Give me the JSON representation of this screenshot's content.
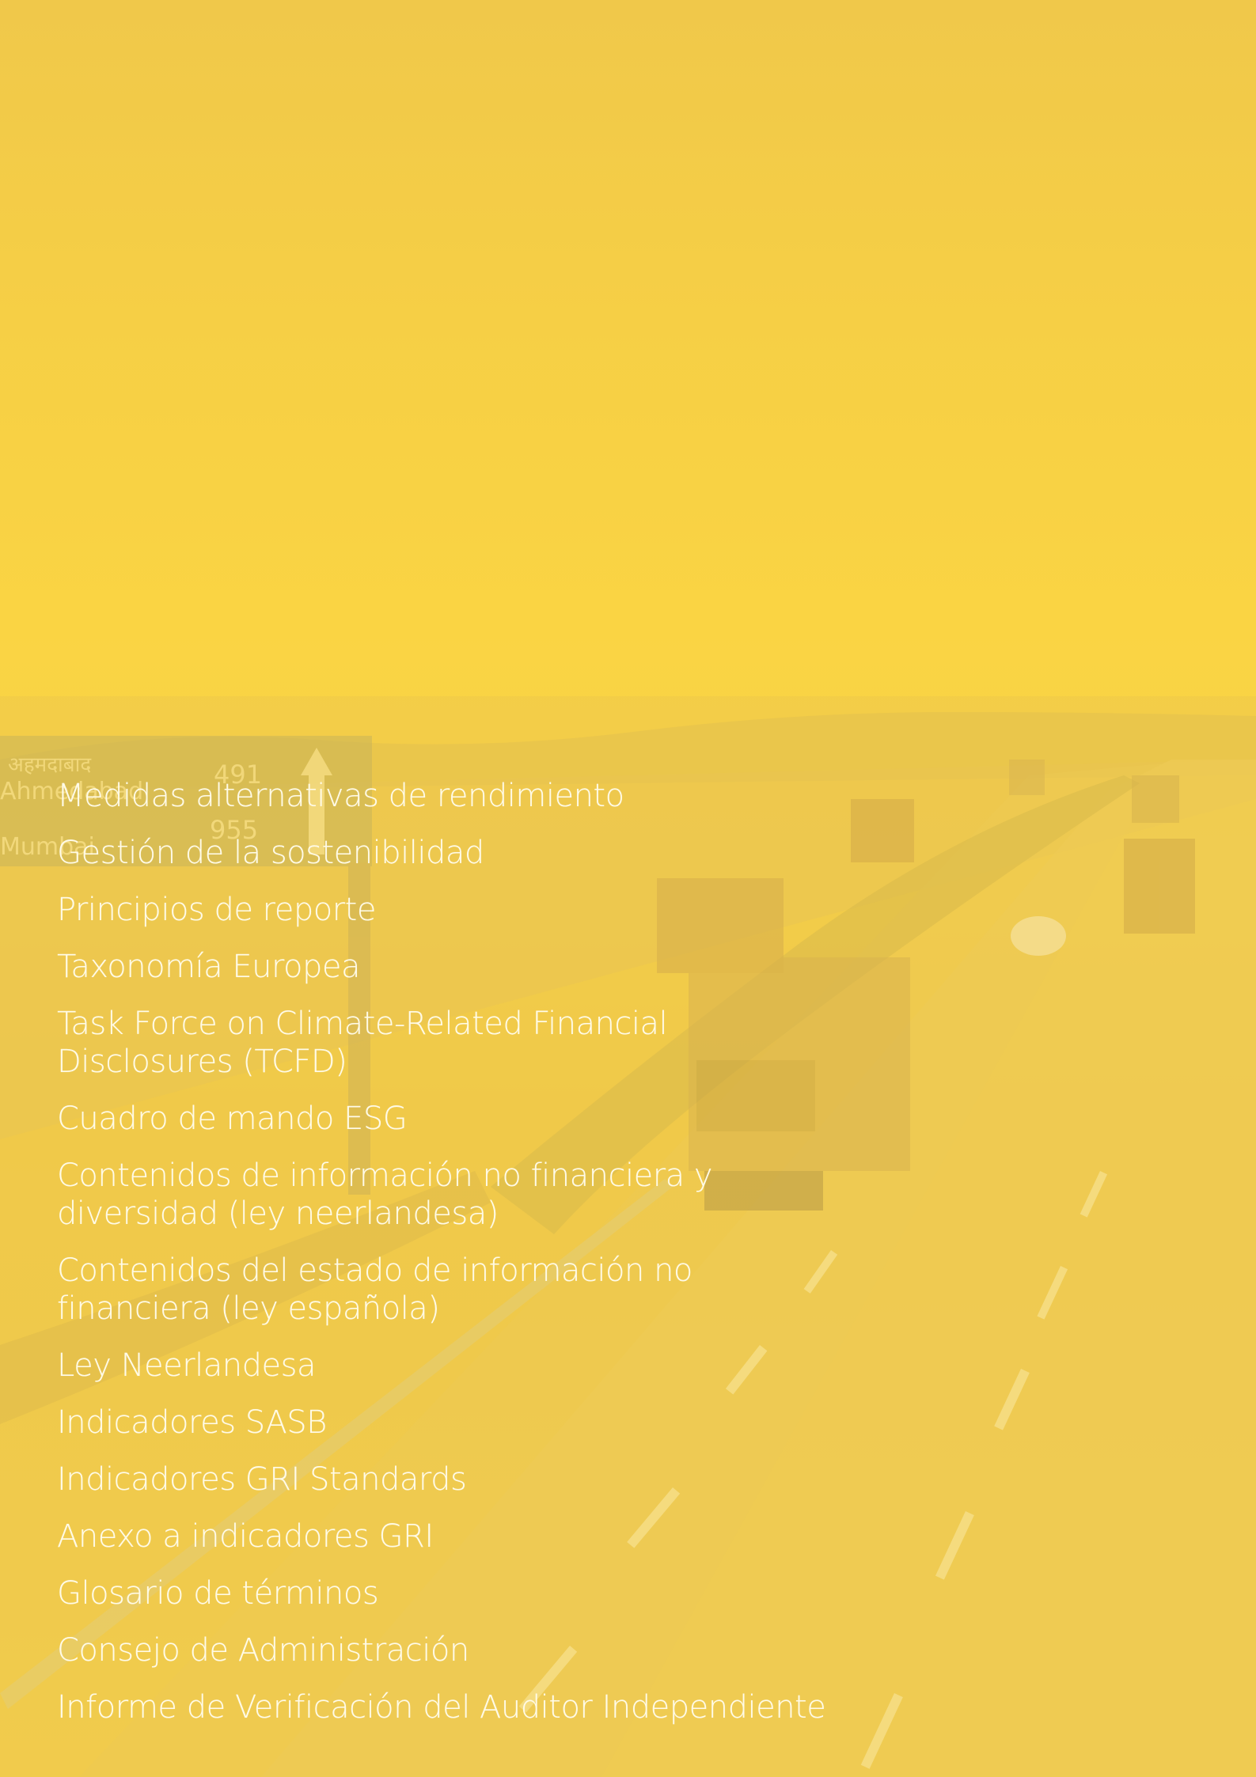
{
  "colors": {
    "overlay": "#f5cf45",
    "text": "#fffbe8"
  },
  "background": {
    "sign_text": [
      "अहमदाबाद",
      "Ahmedabad",
      "Mumbai"
    ],
    "sign_distances": [
      "491",
      "955"
    ]
  },
  "toc": {
    "items": [
      "Medidas alternativas de rendimiento",
      "Gestión de la sostenibilidad",
      "Principios de reporte",
      "Taxonomía Europea",
      "Task Force on Climate-Related Financial\nDisclosures  (TCFD)",
      "Cuadro de mando ESG",
      "Contenidos de información no financiera y\ndiversidad (ley neerlandesa)",
      "Contenidos del estado de información no\nfinanciera (ley española)",
      "Ley Neerlandesa",
      "Indicadores SASB",
      "Indicadores GRI Standards",
      "Anexo a indicadores GRI",
      "Glosario de términos",
      "Consejo de Administración",
      "Informe de Verificación del Auditor Independiente"
    ]
  }
}
